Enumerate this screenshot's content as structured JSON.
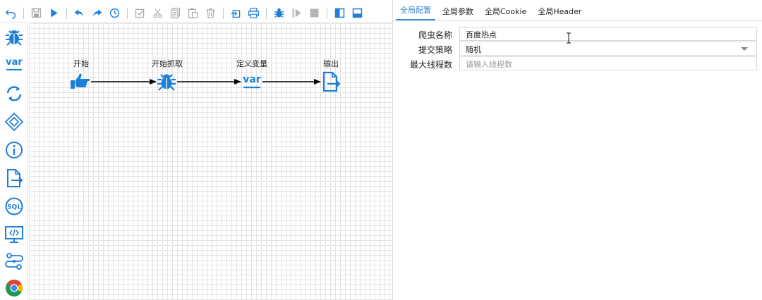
{
  "toolbar": {
    "buttons": [
      "undo-icon",
      "save-icon",
      "run-icon",
      "undo-arrow-icon",
      "redo-arrow-icon",
      "history-icon",
      "select-all-icon",
      "cut-icon",
      "copy-icon",
      "paste-icon",
      "delete-icon",
      "export-icon",
      "print-icon",
      "debug-icon",
      "resume-icon",
      "stop-icon",
      "toggle-left-panel-icon",
      "toggle-bottom-panel-icon"
    ]
  },
  "palette": {
    "items": [
      "spider-icon",
      "variable-icon",
      "loop-icon",
      "condition-icon",
      "info-icon",
      "output-icon",
      "sql-icon",
      "script-icon",
      "function-icon",
      "chrome-icon"
    ]
  },
  "flow": {
    "nodes": [
      {
        "label": "开始",
        "icon": "start-hand-icon"
      },
      {
        "label": "开始抓取",
        "icon": "spider-icon"
      },
      {
        "label": "定义变量",
        "icon": "variable-icon"
      },
      {
        "label": "输出",
        "icon": "output-icon"
      }
    ]
  },
  "panel": {
    "tabs": [
      "全局配置",
      "全局参数",
      "全局Cookie",
      "全局Header"
    ],
    "fields": [
      {
        "label": "爬虫名称",
        "value": "百度热点",
        "placeholder": ""
      },
      {
        "label": "提交策略",
        "value": "随机",
        "placeholder": ""
      },
      {
        "label": "最大线程数",
        "value": "",
        "placeholder": "请输入线程数"
      }
    ]
  },
  "colors": {
    "accent": "#1e7fd8",
    "gray_icon": "#a8a8a8",
    "tab_active": "#3a86d6"
  }
}
